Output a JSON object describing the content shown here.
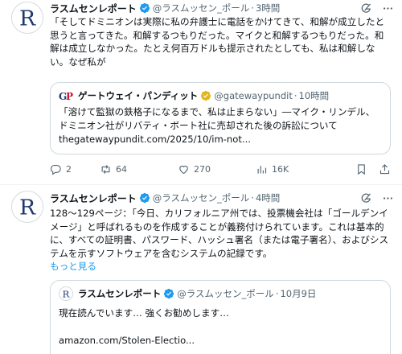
{
  "tweets": [
    {
      "name": "ラスムセンレポート",
      "handle": "@ラスムッセン_ポール",
      "time": "3時間",
      "text": "「そしてドミニオンは実際に私の弁護士に電話をかけてきて、和解が成立したと思うと言ってきた。和解するつもりだった。マイクと和解するつもりだった。和解は成立しなかった。たとえ何百万ドルも提示されたとしても、私は和解しない。なぜ私が",
      "quote": {
        "logo_text": "GP",
        "name": "ゲートウェイ・パンディット",
        "handle": "@gatewaypundit",
        "time": "10時間",
        "text": "「溶けて監獄の鉄格子になるまで、私は止まらない」―マイク・リンデル、ドミニオン社がリバティ・ボート社に売却された後の訴訟について",
        "link": "thegatewaypundit.com/2025/10/im-not..."
      },
      "stats": {
        "replies": "2",
        "retweets": "64",
        "likes": "270",
        "views": "16K"
      }
    },
    {
      "name": "ラスムセンレポート",
      "handle": "@ラスムッセン_ポール",
      "time": "4時間",
      "text": "128～129ページ：「今日、カリフォルニア州では、投票機会社は「ゴールデンイメージ」と呼ばれるものを作成することが義務付けられています。これは基本的に、すべての証明書、パスワード、ハッシュ署名（または電子署名）、およびシステムを示すソフトウェアを含むシステムの記録です。",
      "show_more": "もっと見る",
      "quote": {
        "name": "ラスムセンレポート",
        "handle": "@ラスムッセン_ポール",
        "time": "10月9日",
        "text": "現在読んでいます… 強くお勧めします…",
        "link": "amazon.com/Stolen-Electio..."
      }
    }
  ],
  "colors": {
    "accent": "#1d9bf0",
    "muted": "#536471",
    "text": "#0f1419",
    "gp_red": "#c8102e",
    "gp_navy": "#1f3a6e"
  },
  "icons": [
    "verified-badge-icon",
    "grok-icon",
    "more-icon",
    "reply-icon",
    "retweet-icon",
    "like-icon",
    "views-icon",
    "bookmark-icon",
    "share-icon"
  ]
}
